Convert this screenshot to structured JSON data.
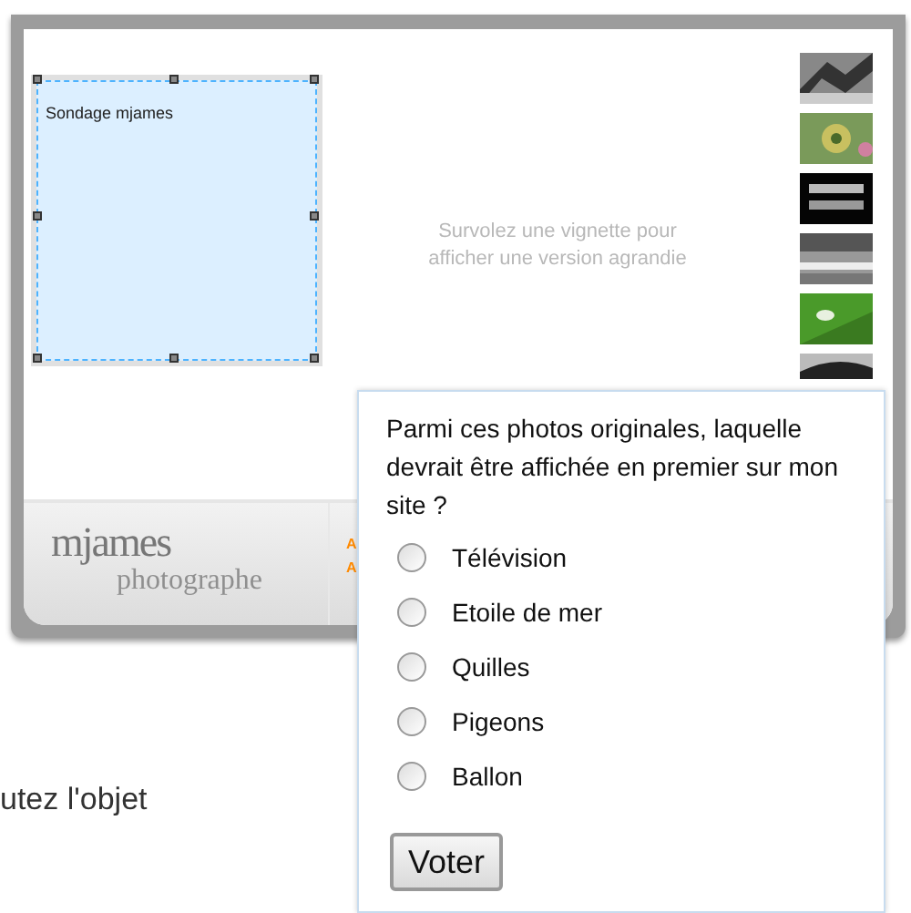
{
  "editor_box": {
    "title": "Sondage mjames"
  },
  "gallery": {
    "hint": "Survolez une vignette pour afficher une version agrandie"
  },
  "footer": {
    "logo": "mjames",
    "tagline": "photographe",
    "links": [
      "A",
      "A"
    ]
  },
  "body_text": "utez l'objet",
  "poll": {
    "question": "Parmi ces photos originales, laquelle devrait être affichée en premier sur mon site ?",
    "options": [
      {
        "label": "Télévision",
        "selected": false
      },
      {
        "label": "Etoile de mer",
        "selected": false
      },
      {
        "label": "Quilles",
        "selected": false
      },
      {
        "label": "Pigeons",
        "selected": false
      },
      {
        "label": "Ballon",
        "selected": false
      }
    ],
    "button": "Voter"
  }
}
